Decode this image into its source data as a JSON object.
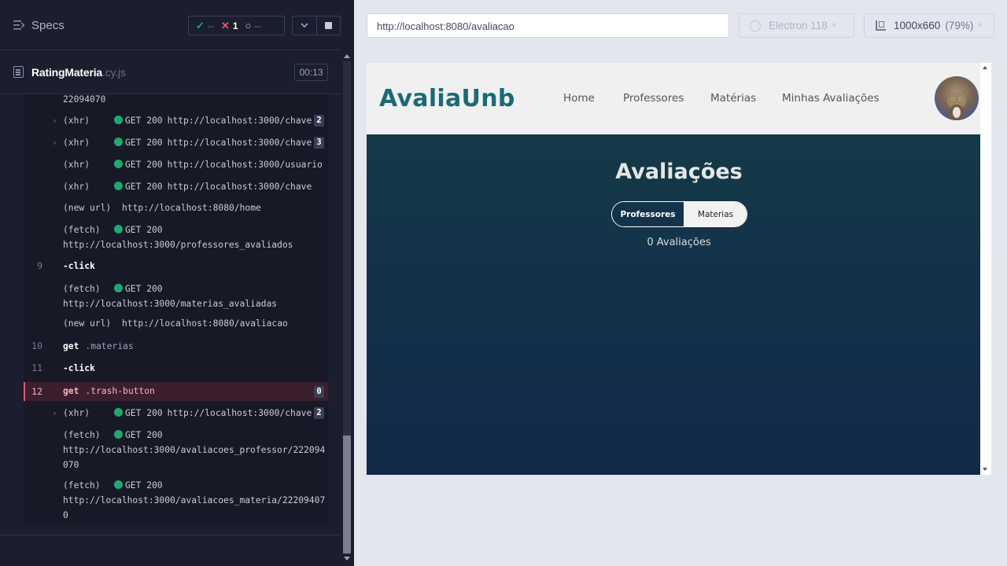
{
  "reporter": {
    "specs_label": "Specs",
    "stats": {
      "passed": "--",
      "failed": "1",
      "pending": "--"
    },
    "spec": {
      "name": "RatingMateria",
      "ext": ".cy.js",
      "duration": "00:13"
    },
    "commands": [
      {
        "kind": "cont",
        "text": "22094070"
      },
      {
        "kind": "req",
        "toggle": true,
        "type": "(xhr)",
        "method": "GET 200",
        "url": "http://localhost:3000/chave",
        "badge": "2"
      },
      {
        "kind": "req",
        "toggle": true,
        "type": "(xhr)",
        "method": "GET 200",
        "url": "http://localhost:3000/chave",
        "badge": "3"
      },
      {
        "kind": "req",
        "type": "(xhr)",
        "method": "GET 200",
        "url": "http://localhost:3000/usuario"
      },
      {
        "kind": "req",
        "type": "(xhr)",
        "method": "GET 200",
        "url": "http://localhost:3000/chave"
      },
      {
        "kind": "newurl",
        "type": "(new url)",
        "url": "http://localhost:8080/home"
      },
      {
        "kind": "fetch",
        "type": "(fetch)",
        "method": "GET 200",
        "url": "http://localhost:3000/professores_avaliados"
      },
      {
        "kind": "cmd",
        "num": "9",
        "name": "-click",
        "selector": ""
      },
      {
        "kind": "fetch",
        "type": "(fetch)",
        "method": "GET 200",
        "url": "http://localhost:3000/materias_avaliadas"
      },
      {
        "kind": "newurl",
        "type": "(new url)",
        "url": "http://localhost:8080/avaliacao"
      },
      {
        "kind": "cmd",
        "num": "10",
        "name": "get",
        "selector": ".materias"
      },
      {
        "kind": "cmd",
        "num": "11",
        "name": "-click",
        "selector": ""
      },
      {
        "kind": "cmd",
        "num": "12",
        "name": "get",
        "selector": ".trash-button",
        "badge": "0",
        "failed": true
      },
      {
        "kind": "req",
        "toggle": true,
        "type": "(xhr)",
        "method": "GET 200",
        "url": "http://localhost:3000/chave",
        "badge": "2"
      },
      {
        "kind": "fetch",
        "type": "(fetch)",
        "method": "GET 200",
        "url": "http://localhost:3000/avaliacoes_professor/222094070"
      },
      {
        "kind": "fetch",
        "type": "(fetch)",
        "method": "GET 200",
        "url": "http://localhost:3000/avaliacoes_materia/222094070"
      }
    ]
  },
  "aut": {
    "url": "http://localhost:8080/avaliacao",
    "browser": "Electron 118",
    "viewport": "1000x660",
    "zoom": "(79%)"
  },
  "app": {
    "brand": "AvaliaUnb",
    "nav": [
      "Home",
      "Professores",
      "Matérias",
      "Minhas Avaliações"
    ],
    "heading": "Avaliações",
    "toggle": {
      "active": "Professores",
      "inactive": "Materias"
    },
    "count": "0 Avaliações"
  },
  "colors": {
    "passed": "#1fa971",
    "failed": "#e45770",
    "brand": "#1b6a75",
    "main_bg_top": "#143a48",
    "main_bg_bottom": "#132948"
  }
}
